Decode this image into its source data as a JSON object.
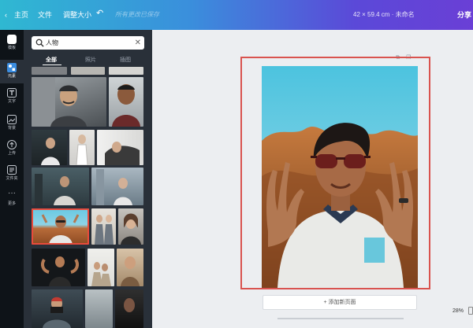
{
  "topbar": {
    "back_icon": "chevron-left-icon",
    "home": "主页",
    "file": "文件",
    "resize": "调整大小",
    "undo_icon": "undo-icon",
    "saved": "所有更改已保存",
    "doc_size": "42 × 59.4 cm · 未命名",
    "share": "分享"
  },
  "rail": {
    "items": [
      {
        "label": "模板",
        "icon": "template-logo-icon"
      },
      {
        "label": "元素",
        "icon": "elements-icon"
      },
      {
        "label": "文字",
        "icon": "text-icon"
      },
      {
        "label": "背景",
        "icon": "background-icon"
      },
      {
        "label": "上传",
        "icon": "upload-icon"
      },
      {
        "label": "文件夹",
        "icon": "folder-icon"
      },
      {
        "label": "更多",
        "icon": "more-icon"
      }
    ]
  },
  "panel": {
    "search": {
      "value": "人物",
      "icon": "search-icon",
      "clear_icon": "close-icon"
    },
    "tabs": [
      {
        "label": "全部",
        "active": true
      },
      {
        "label": "照片",
        "active": false
      },
      {
        "label": "插图",
        "active": false
      }
    ]
  },
  "workspace": {
    "add_page": "+ 添加新页面",
    "zoom": "28%",
    "page_tool_icons": [
      "copy-page-icon",
      "duplicate-page-icon"
    ]
  },
  "colors": {
    "topbar_start": "#2fb8d2",
    "topbar_end": "#6a3fd6",
    "rail": "#0e1318",
    "panel": "#293039",
    "selection": "#d9534f"
  }
}
